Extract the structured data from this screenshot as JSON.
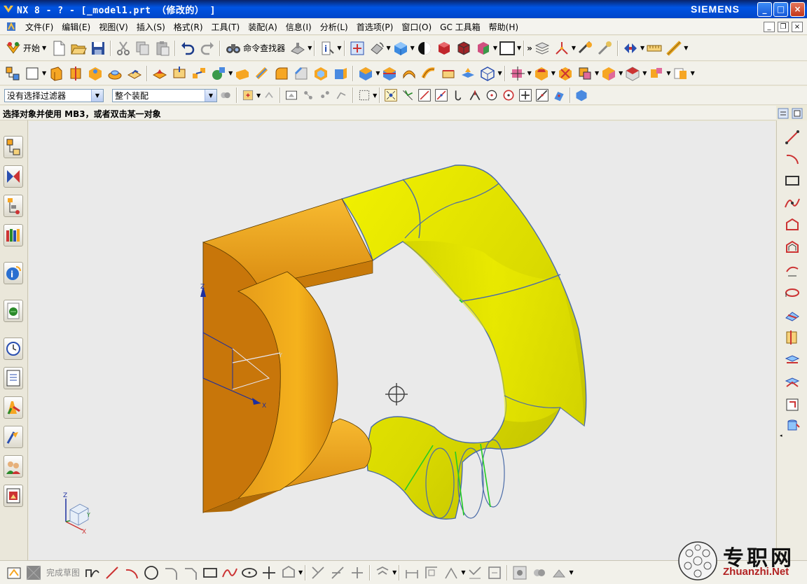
{
  "window": {
    "title": "NX 8 - ? - [_model1.prt （修改的） ]",
    "brand": "SIEMENS",
    "controls": {
      "minimize": "_",
      "maximize": "□",
      "close": "×"
    }
  },
  "menubar": {
    "items": [
      "文件(F)",
      "编辑(E)",
      "视图(V)",
      "插入(S)",
      "格式(R)",
      "工具(T)",
      "装配(A)",
      "信息(I)",
      "分析(L)",
      "首选项(P)",
      "窗口(O)",
      "GC 工具箱",
      "帮助(H)"
    ],
    "doc_controls": [
      "_",
      "❐",
      "×"
    ]
  },
  "toolbar1": {
    "start_label": "开始",
    "command_finder_label": "命令查找器"
  },
  "selection_bar": {
    "filter_value": "没有选择过滤器",
    "scope_value": "整个装配"
  },
  "cue_line": "选择对象并使用 MB3，或者双击某一对象",
  "sketch_bar": {
    "finish_sketch_label": "完成草图"
  },
  "viewport": {
    "axis_labels": {
      "z": "Z",
      "x": "X",
      "y": "Y"
    },
    "colors": {
      "orange_dark": "#C8760A",
      "orange_light": "#F5B21C",
      "yellow_dark": "#B8B800",
      "yellow_light": "#F2F200",
      "edge_blue": "#4A6BA8",
      "edge_green": "#22CC22"
    }
  },
  "watermark": {
    "cn": "专职网",
    "en": "Zhuanzhi.Net"
  }
}
